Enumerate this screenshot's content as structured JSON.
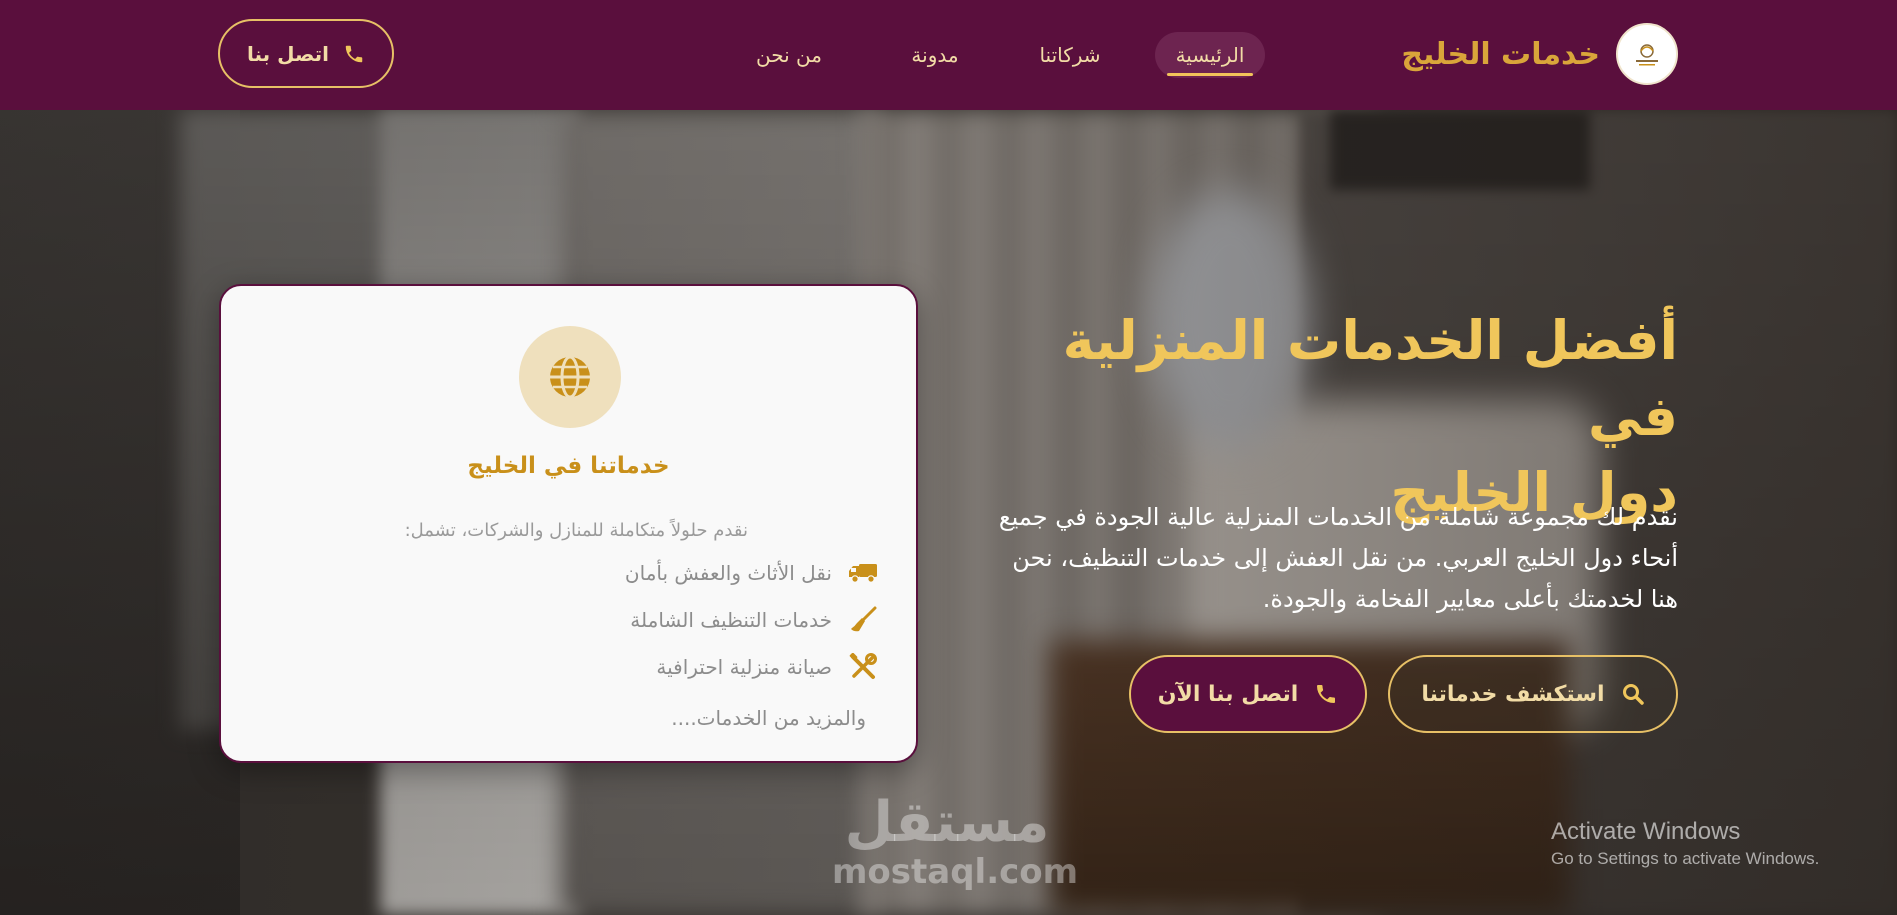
{
  "header": {
    "brand_name": "خدمات الخليج",
    "nav": [
      {
        "label": "الرئيسية",
        "active": true
      },
      {
        "label": "شركاتنا",
        "active": false
      },
      {
        "label": "مدونة",
        "active": false
      },
      {
        "label": "من نحن",
        "active": false
      }
    ],
    "contact_button": "اتصل بنا"
  },
  "hero": {
    "title_line1": "أفضل الخدمات المنزلية في",
    "title_line2": "دول الخليج",
    "description_line1": "نقدم لك مجموعة شاملة من الخدمات المنزلية عالية الجودة في جميع",
    "description_line2": "أنحاء دول الخليج العربي. من نقل العفش إلى خدمات التنظيف، نحن",
    "description_line3": "هنا لخدمتك بأعلى معايير الفخامة والجودة.",
    "explore_button": "استكشف خدماتنا",
    "contact_now_button": "اتصل بنا الآن"
  },
  "card": {
    "title": "خدماتنا في الخليج",
    "intro": "نقدم حلولاً متكاملة للمنازل والشركات، تشمل:",
    "items": [
      {
        "icon": "truck-icon",
        "label": "نقل الأثاث والعفش بأمان"
      },
      {
        "icon": "broom-icon",
        "label": "خدمات التنظيف الشاملة"
      },
      {
        "icon": "tools-icon",
        "label": "صيانة منزلية احترافية"
      }
    ],
    "more": "والمزيد من الخدمات...."
  },
  "watermark": {
    "mostaql_ar": "مستقل",
    "mostaql_en": "mostaql.com"
  },
  "os_notice": {
    "title": "Activate Windows",
    "subtitle": "Go to Settings to activate Windows."
  },
  "colors": {
    "primary": "#5a0f3d",
    "gold": "#f0c65b",
    "gold_dark": "#c9901a"
  }
}
